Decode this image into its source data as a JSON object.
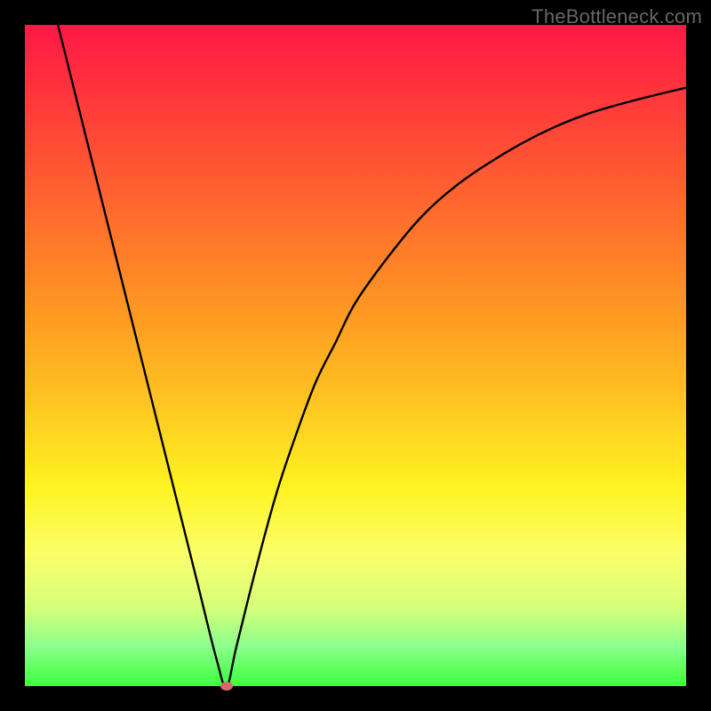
{
  "watermark": "TheBottleneck.com",
  "colors": {
    "background": "#000000",
    "curve": "#000000",
    "marker": "#d66a6a"
  },
  "chart_data": {
    "type": "line",
    "title": "",
    "xlabel": "",
    "ylabel": "",
    "xlim": [
      0,
      100
    ],
    "ylim": [
      0,
      100
    ],
    "grid": false,
    "series": [
      {
        "name": "bottleneck-curve",
        "x": [
          5,
          8,
          11,
          14,
          17,
          20,
          23,
          26,
          29,
          30.5,
          32,
          35,
          38,
          41,
          44,
          47,
          50,
          55,
          60,
          65,
          70,
          75,
          80,
          85,
          90,
          95,
          100
        ],
        "y": [
          100,
          88,
          76,
          64,
          52,
          40,
          28,
          16,
          4,
          0,
          6,
          18,
          29,
          38,
          46,
          52,
          58,
          65,
          71,
          75.5,
          79,
          82,
          84.5,
          86.5,
          88,
          89.3,
          90.5
        ]
      }
    ],
    "annotations": [
      {
        "name": "min-marker",
        "x": 30.5,
        "y": 0
      }
    ]
  }
}
